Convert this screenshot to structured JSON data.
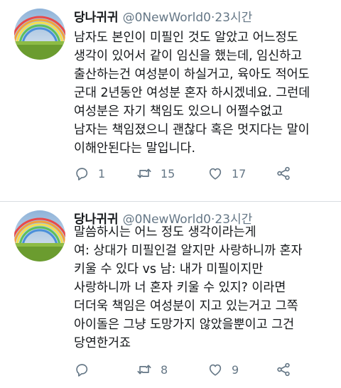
{
  "tweets": [
    {
      "display_name": "당나귀귀",
      "handle": "@0NewWorld0",
      "separator": "·",
      "time": "23시간",
      "lines": [
        "남자도 본인이 미필인 것도 알았고 어느정도",
        "생각이 있어서 같이 임신을 했는데, 임신하고",
        "출산하는건 여성분이 하실거고, 육아도 적어도",
        "군대 2년동안 여성분 혼자 하시겠네요. 그런데",
        "여성분은 자기 책임도 있으니 어쩔수없고",
        "남자는 책임졌으니 괜찮다 혹은 멋지다는 말이",
        "이해안된다는 말입니다."
      ],
      "reply_count": "1",
      "retweet_count": "15",
      "like_count": "17"
    },
    {
      "display_name": "당나귀귀",
      "handle": "@0NewWorld0",
      "separator": "·",
      "time": "23시간",
      "lines": [
        "말씀하시는 어느 정도 생각이라는게",
        "여: 상대가 미필인걸 알지만 사랑하니까 혼자",
        "키울 수 있다 vs 남: 내가 미필이지만",
        "사랑하니까 너 혼자 키울 수 있지? 이라면",
        "더더욱 책임은 여성분이 지고 있는거고 그쪽",
        "아이돌은 그냥 도망가지 않았을뿐이고 그건",
        "당연한거죠"
      ],
      "reply_count": "",
      "retweet_count": "8",
      "like_count": "9"
    }
  ],
  "icons": {
    "reply": "reply-icon",
    "retweet": "retweet-icon",
    "like": "like-icon",
    "share": "share-icon"
  },
  "colors": {
    "text": "#14171a",
    "secondary": "#657786",
    "divider": "#d9dde1"
  }
}
